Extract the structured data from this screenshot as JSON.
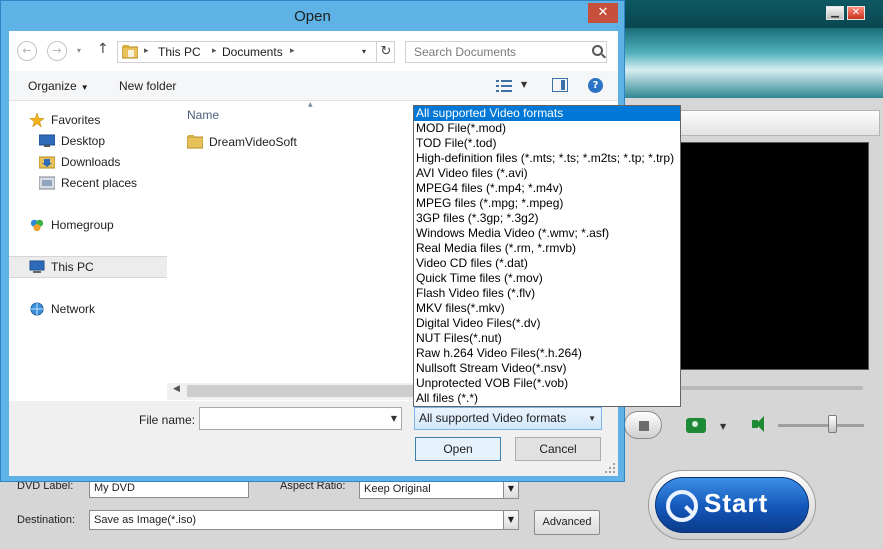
{
  "app": {
    "minimize_glyph": "▁",
    "close_glyph": "✕",
    "dvd_label_label": "DVD Label:",
    "dvd_label_value": "My DVD",
    "aspect_ratio_label": "Aspect Ratio:",
    "aspect_ratio_value": "Keep Original",
    "destination_label": "Destination:",
    "destination_value": "Save as Image(*.iso)",
    "advanced_label": "Advanced",
    "start_label": "Start",
    "dropdown_glyph": "▼"
  },
  "dialog": {
    "title": "Open",
    "close_glyph": "✕",
    "nav": {
      "back_glyph": "←",
      "forward_glyph": "→",
      "recent_glyph": "▾",
      "up_glyph": "↑",
      "breadcrumb": [
        "This PC",
        "Documents"
      ],
      "breadcrumb_sep": "▸",
      "address_dd_glyph": "▾",
      "refresh_glyph": "↻",
      "search_placeholder": "Search Documents"
    },
    "toolbar": {
      "organize_label": "Organize",
      "organize_caret": "▼",
      "new_folder_label": "New folder",
      "view_dd_glyph": "▼",
      "help_glyph": "?"
    },
    "nav_pane": {
      "favorites": "Favorites",
      "desktop": "Desktop",
      "downloads": "Downloads",
      "recent_places": "Recent places",
      "homegroup": "Homegroup",
      "this_pc": "This PC",
      "network": "Network"
    },
    "file_list": {
      "column_name": "Name",
      "sort_glyph": "▲",
      "items": [
        "DreamVideoSoft"
      ]
    },
    "scroll_left_glyph": "◀",
    "file_name_label": "File name:",
    "file_name_value": "",
    "file_name_dd_glyph": "▼",
    "filter_selected": "All supported Video formats",
    "filter_dd_glyph": "▼",
    "open_label": "Open",
    "cancel_label": "Cancel",
    "filter_options": [
      "All supported Video formats",
      "MOD File(*.mod)",
      "TOD File(*.tod)",
      "High-definition files (*.mts; *.ts; *.m2ts; *.tp; *.trp)",
      "AVI Video files (*.avi)",
      "MPEG4 files (*.mp4; *.m4v)",
      "MPEG files (*.mpg; *.mpeg)",
      "3GP files (*.3gp; *.3g2)",
      "Windows Media Video (*.wmv; *.asf)",
      "Real Media files (*.rm, *.rmvb)",
      "Video CD files (*.dat)",
      "Quick Time files (*.mov)",
      "Flash Video files (*.flv)",
      "MKV files(*.mkv)",
      "Digital Video Files(*.dv)",
      "NUT Files(*.nut)",
      "Raw h.264 Video Files(*.h.264)",
      "Nullsoft Stream Video(*.nsv)",
      "Unprotected VOB File(*.vob)",
      "All files (*.*)"
    ]
  },
  "colors": {
    "dialog_frame": "#5eb2e6",
    "selection": "#0078d7",
    "start_button": "#1356b9",
    "preview": "#000000"
  }
}
